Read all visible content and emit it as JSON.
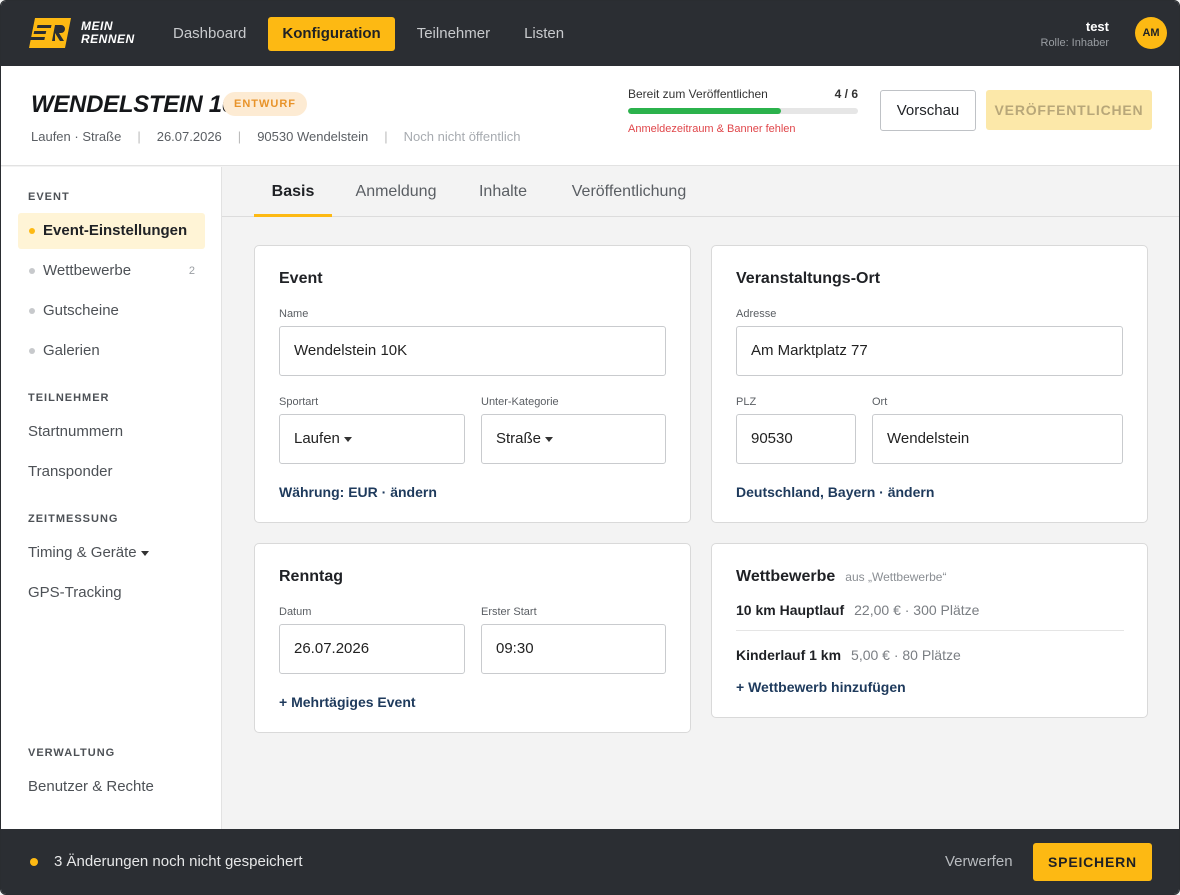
{
  "brand": {
    "line1": "MEIN",
    "line2": "RENNEN",
    "accent": "#fdb913"
  },
  "nav": {
    "items": [
      {
        "label": "Dashboard"
      },
      {
        "label": "Konfiguration",
        "active": true
      },
      {
        "label": "Teilnehmer"
      },
      {
        "label": "Listen"
      }
    ]
  },
  "user": {
    "name": "test",
    "role": "Rolle: Inhaber",
    "initials": "AM"
  },
  "event": {
    "title": "WENDELSTEIN 10K",
    "status_badge": "ENTWURF",
    "meta": {
      "sport": "Laufen · Straße",
      "date": "26.07.2026",
      "location": "90530 Wendelstein",
      "visibility": "Noch nicht öffentlich"
    }
  },
  "readiness": {
    "label": "Bereit zum Veröffentlichen",
    "count": "4 / 6",
    "fraction": 0.667,
    "warning": "Anmeldezeitraum & Banner fehlen",
    "bar_color": "#2bb24c",
    "warning_color": "#e0464a"
  },
  "actions": {
    "preview": "Vorschau",
    "publish": "VERÖFFENTLICHEN"
  },
  "sidebar": {
    "sections": [
      {
        "title": "EVENT"
      },
      {
        "title": "TEILNEHMER"
      },
      {
        "title": "ZEITMESSUNG"
      },
      {
        "title": "VERWALTUNG"
      }
    ],
    "items": {
      "event_settings": "Event-Einstellungen",
      "competitions": "Wettbewerbe",
      "competitions_count": "2",
      "vouchers": "Gutscheine",
      "galleries": "Galerien",
      "bib_numbers": "Startnummern",
      "transponder": "Transponder",
      "timing": "Timing & Geräte",
      "gps": "GPS-Tracking",
      "users": "Benutzer & Rechte"
    }
  },
  "tabs": [
    {
      "label": "Basis",
      "active": true
    },
    {
      "label": "Anmeldung"
    },
    {
      "label": "Inhalte"
    },
    {
      "label": "Veröffentlichung"
    }
  ],
  "card_event": {
    "title": "Event",
    "name_label": "Name",
    "name_value": "Wendelstein 10K",
    "sport_label": "Sportart",
    "sport_value": "Laufen",
    "subcat_label": "Unter-Kategorie",
    "subcat_value": "Straße",
    "currency_link": "Währung: EUR · ändern"
  },
  "card_venue": {
    "title": "Veranstaltungs-Ort",
    "address_label": "Adresse",
    "address_value": "Am  Marktplatz 77",
    "zip_label": "PLZ",
    "zip_value": "90530",
    "city_label": "Ort",
    "city_value": "Wendelstein",
    "region_link": "Deutschland, Bayern · ändern"
  },
  "card_raceday": {
    "title": "Renntag",
    "date_label": "Datum",
    "date_value": "26.07.2026",
    "start_label": "Erster Start",
    "start_value": "09:30",
    "multiday_link": "+ Mehrtägiges Event"
  },
  "card_competitions": {
    "title": "Wettbewerbe",
    "source_note": "aus „Wettbewerbe“",
    "rows": [
      {
        "name": "10 km Hauptlauf",
        "meta": "22,00 € · 300 Plätze"
      },
      {
        "name": "Kinderlauf 1 km",
        "meta": "5,00 € · 80 Plätze"
      }
    ],
    "add_link": "+ Wettbewerb hinzufügen"
  },
  "footer": {
    "unsaved": "3 Änderungen noch nicht gespeichert",
    "discard": "Verwerfen",
    "save": "SPEICHERN"
  }
}
